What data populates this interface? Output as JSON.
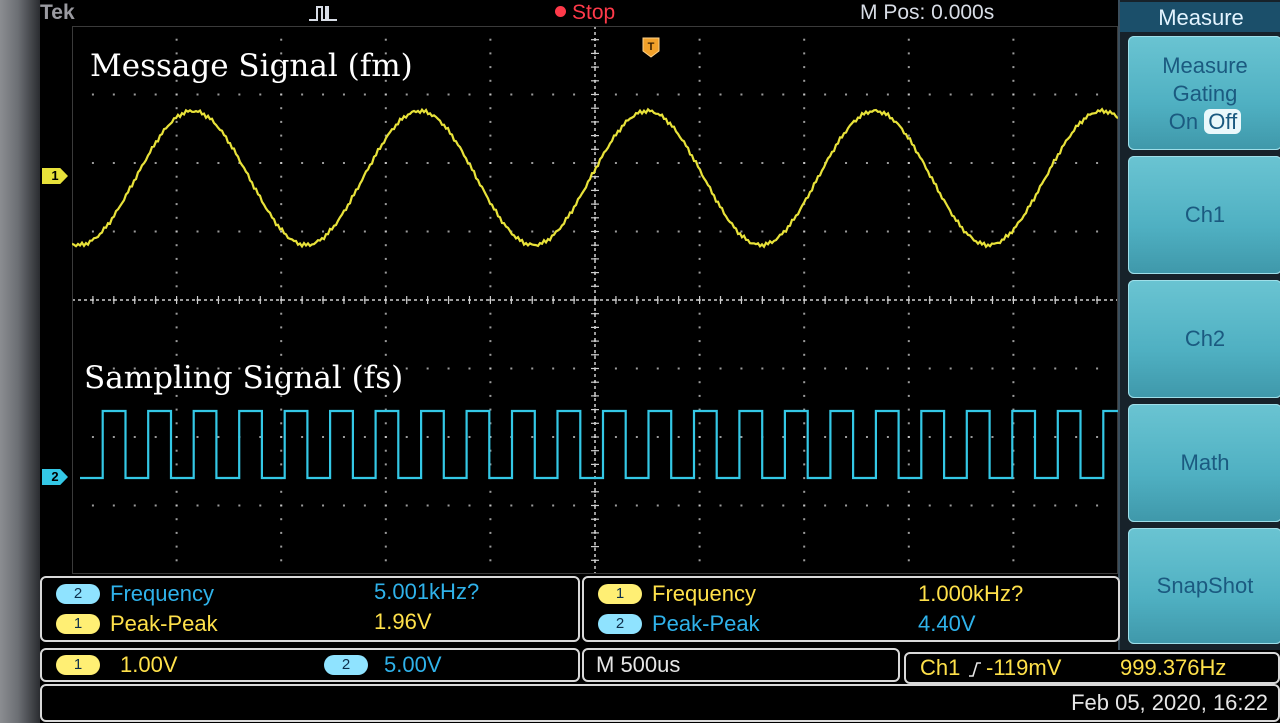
{
  "header": {
    "brand": "Tek",
    "acquisition_state": "Stop",
    "horizontal_position": "M Pos: 0.000s"
  },
  "overlays": {
    "message_signal_label": "Message Signal (fm)",
    "sampling_signal_label": "Sampling Signal (fs)"
  },
  "channel_markers": {
    "ch1": "1",
    "ch2": "2"
  },
  "menu": {
    "title": "Measure",
    "buttons": [
      {
        "label_lines": [
          "Measure",
          "Gating"
        ],
        "toggle_on": "On",
        "toggle_off": "Off",
        "selected": "Off"
      },
      {
        "label": "Ch1"
      },
      {
        "label": "Ch2"
      },
      {
        "label": "Math"
      },
      {
        "label": "SnapShot"
      }
    ]
  },
  "measurements": {
    "left": [
      {
        "channel": "2",
        "name": "Frequency",
        "value": "5.001kHz?"
      },
      {
        "channel": "1",
        "name": "Peak-Peak",
        "value": "1.96V"
      }
    ],
    "right": [
      {
        "channel": "1",
        "name": "Frequency",
        "value": "1.000kHz?"
      },
      {
        "channel": "2",
        "name": "Peak-Peak",
        "value": "4.40V"
      }
    ]
  },
  "status": {
    "ch1_badge": "1",
    "ch1_scale": "1.00V",
    "ch2_badge": "2",
    "ch2_scale": "5.00V",
    "timebase": "M 500us",
    "trigger": "Ch1 ⅀ -119mV",
    "trigger_source": "Ch1",
    "trigger_level": "-119mV",
    "trigger_frequency": "999.376Hz"
  },
  "datetime": "Feb 05, 2020, 16:22",
  "colors": {
    "ch1": "#e8e23a",
    "ch2": "#34c8e6",
    "graticule": "#cfcfcf",
    "menu_button": "#5bbccd",
    "stop": "#ff3a4a"
  },
  "waveforms": {
    "ch1": {
      "shape": "sine",
      "cycles_on_screen": 4.6,
      "frequency": "1.000kHz?",
      "peak_to_peak": "1.96V"
    },
    "ch2": {
      "shape": "square",
      "cycles_on_screen": 23,
      "frequency": "5.001kHz?",
      "peak_to_peak": "4.40V"
    }
  }
}
